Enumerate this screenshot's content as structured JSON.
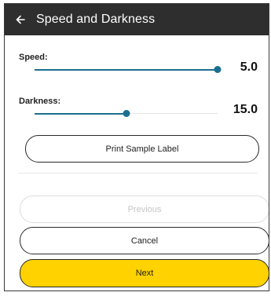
{
  "header": {
    "title": "Speed and Darkness",
    "back_icon": "arrow-left-icon"
  },
  "settings": {
    "speed": {
      "label": "Speed:",
      "value": "5.0",
      "fraction": 1.0
    },
    "darkness": {
      "label": "Darkness:",
      "value": "15.0",
      "fraction": 0.5
    }
  },
  "actions": {
    "print_sample": "Print Sample Label",
    "previous": "Previous",
    "cancel": "Cancel",
    "next": "Next"
  },
  "colors": {
    "accent": "#1a6f91",
    "primary": "#ffd200",
    "header_bg": "#2e2e2e"
  }
}
